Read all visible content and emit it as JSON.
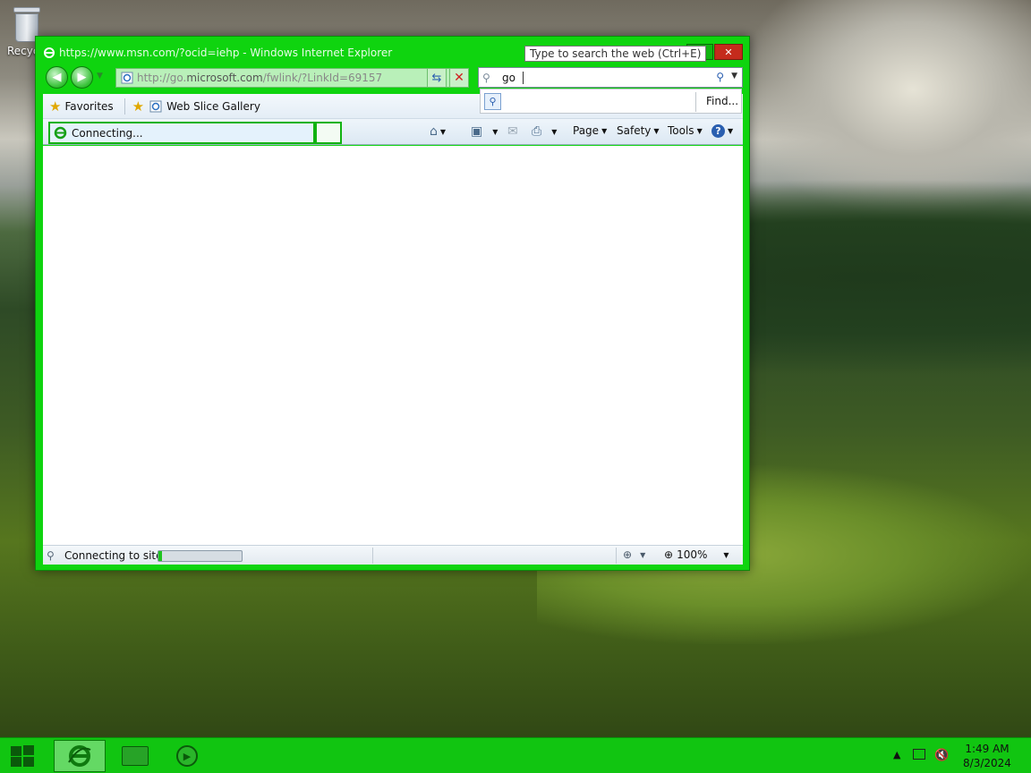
{
  "desktop": {
    "recycle_bin_label": "Recyc"
  },
  "window": {
    "title": "https://www.msn.com/?ocid=iehp - Windows Internet Explorer",
    "minimize_label": "▭",
    "close_label": "✕",
    "search_tooltip": "Type to search the web (Ctrl+E)"
  },
  "navigation": {
    "back_label": "◀",
    "forward_label": "▶",
    "address_prefix": "http://go.",
    "address_domain": "microsoft.com",
    "address_suffix": "/fwlink/?LinkId=69157",
    "refresh_label": "⇆",
    "stop_label": "✕"
  },
  "search": {
    "value": "go",
    "find_label": "Find..."
  },
  "favorites_bar": {
    "favorites_label": "Favorites",
    "items": [
      {
        "label": "Web Slice Gallery"
      }
    ]
  },
  "tabs": [
    {
      "label": "Connecting...",
      "active": true
    }
  ],
  "command_bar": {
    "page_label": "Page",
    "safety_label": "Safety",
    "tools_label": "Tools"
  },
  "status_bar": {
    "text": "Connecting to site ...",
    "progress_percent": 4,
    "zoom": "100%"
  },
  "taskbar": {
    "items": [
      {
        "name": "internet-explorer",
        "active": true
      },
      {
        "name": "file-explorer",
        "active": false
      },
      {
        "name": "media-player",
        "active": false
      }
    ],
    "clock_time": "1:49 AM",
    "clock_date": "8/3/2024"
  },
  "colors": {
    "window_frame": "#0fd40f",
    "taskbar": "#11c511",
    "close_button": "#c42b1c"
  }
}
